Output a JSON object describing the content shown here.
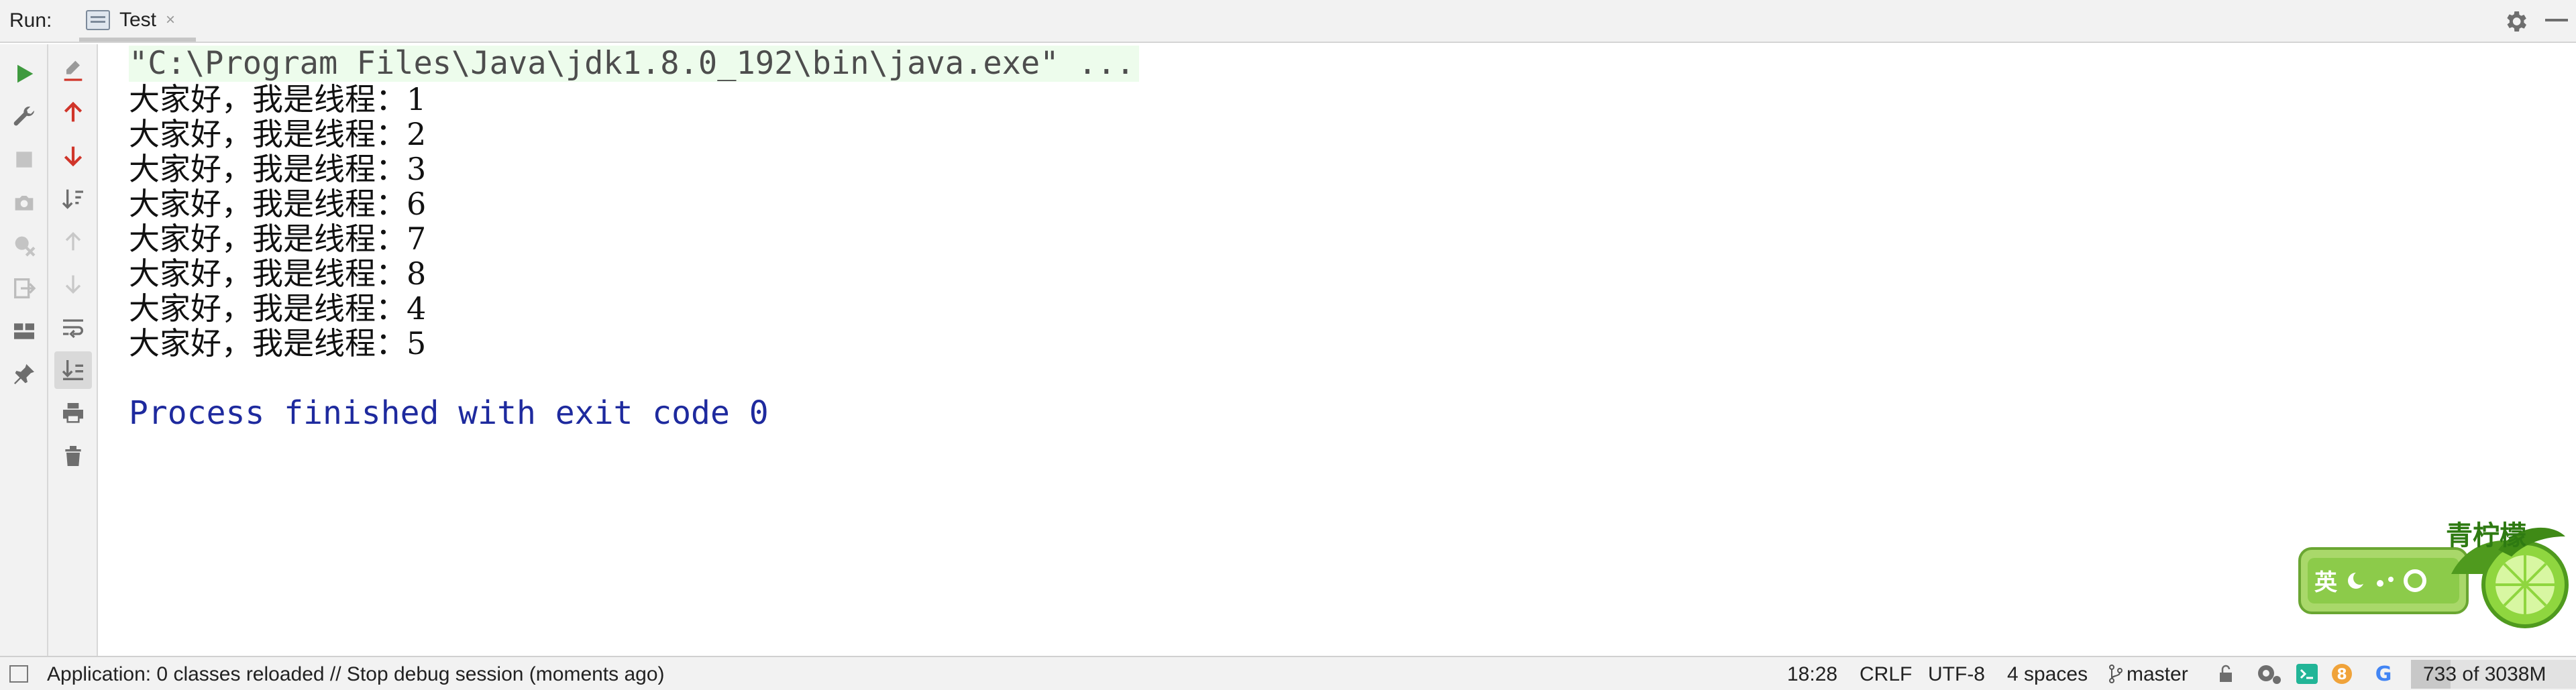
{
  "header": {
    "run_label": "Run:",
    "tab_label": "Test",
    "tab_close": "×"
  },
  "console": {
    "command_line": "\"C:\\Program Files\\Java\\jdk1.8.0_192\\bin\\java.exe\" ...",
    "output_lines": [
      "大家好，我是线程：1",
      "大家好，我是线程：2",
      "大家好，我是线程：3",
      "大家好，我是线程：6",
      "大家好，我是线程：7",
      "大家好，我是线程：8",
      "大家好，我是线程：4",
      "大家好，我是线程：5"
    ],
    "finish_message": "Process finished with exit code 0"
  },
  "ime": {
    "brand": "青柠檬",
    "mode": "英"
  },
  "statusbar": {
    "message": "Application: 0 classes reloaded // Stop debug session (moments ago)",
    "position": "18:28",
    "line_ending": "CRLF",
    "encoding": "UTF-8",
    "indent": "4 spaces",
    "branch": "master",
    "notification_count": "8",
    "memory": "733 of 3038M",
    "memory_fraction": 0.241
  },
  "colors": {
    "run_green": "#3f9a3f",
    "stop_red": "#d0352a",
    "finish_blue": "#1e2a9e",
    "cmd_bg": "#edfcec"
  }
}
